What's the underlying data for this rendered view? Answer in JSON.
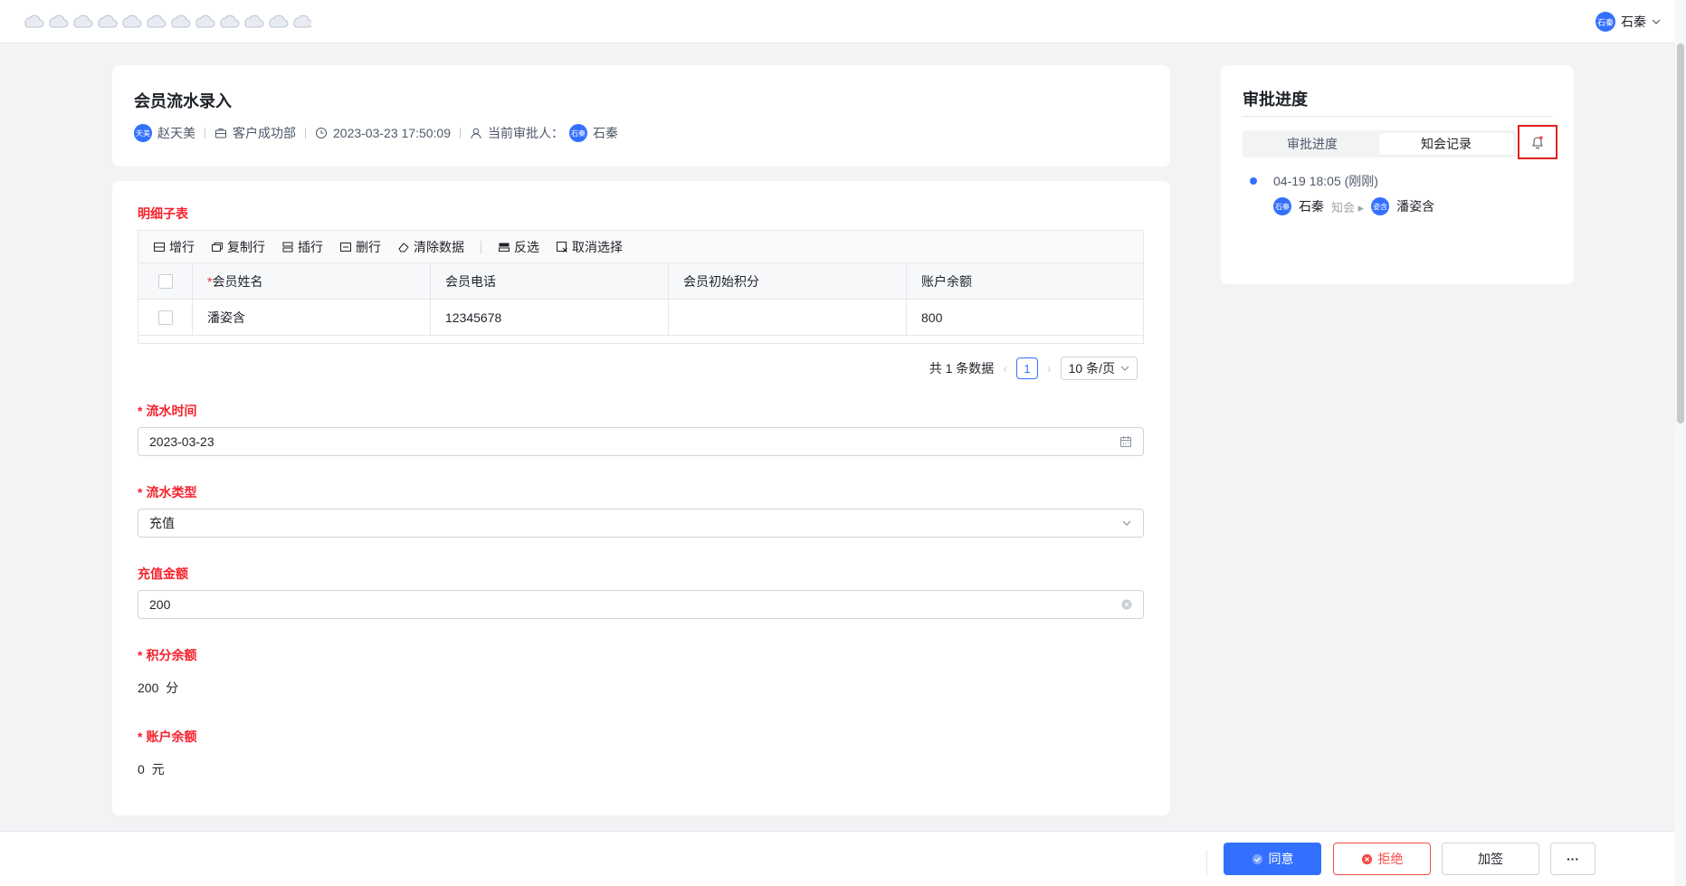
{
  "header": {
    "user_avatar_text": "石秦",
    "user_name": "石秦"
  },
  "record": {
    "title": "会员流水录入",
    "submitter_avatar_text": "天美",
    "submitter": "赵天美",
    "department": "客户成功部",
    "submitted_at": "2023-03-23 17:50:09",
    "approver_label": "当前审批人：",
    "approver_avatar_text": "石秦",
    "approver": "石秦"
  },
  "detail_table": {
    "section_label": "明细子表",
    "toolbar": [
      "增行",
      "复制行",
      "插行",
      "删行",
      "清除数据",
      "反选",
      "取消选择"
    ],
    "columns": [
      "会员姓名",
      "会员电话",
      "会员初始积分",
      "账户余额"
    ],
    "required_column_marker": "*",
    "rows": [
      {
        "name": "潘姿含",
        "phone": "12345678",
        "initial_points": "",
        "balance": "800"
      }
    ],
    "pagination": {
      "total_text": "共 1 条数据",
      "current_page": "1",
      "page_size": "10 条/页"
    }
  },
  "fields": {
    "flow_time": {
      "label": "流水时间",
      "value": "2023-03-23"
    },
    "flow_type": {
      "label": "流水类型",
      "value": "充值"
    },
    "recharge_amount": {
      "label": "充值金额",
      "value": "200"
    },
    "points_balance": {
      "label": "积分余额",
      "value": "200",
      "unit": "分"
    },
    "account_balance": {
      "label": "账户余额",
      "value": "0",
      "unit": "元"
    }
  },
  "approval": {
    "title": "审批进度",
    "tabs": [
      "审批进度",
      "知会记录"
    ],
    "active_tab": "知会记录",
    "timeline": [
      {
        "time": "04-19 18:05 (刚刚)",
        "from_avatar_text": "石秦",
        "from": "石秦",
        "action": "知会",
        "to_avatar_text": "姿含",
        "to": "潘姿含"
      }
    ]
  },
  "footer": {
    "agree": "同意",
    "reject": "拒绝",
    "add_sign": "加签",
    "more": "···"
  },
  "colors": {
    "primary": "#3370ff",
    "danger": "#f54a45",
    "highlight_box": "#e02020"
  }
}
